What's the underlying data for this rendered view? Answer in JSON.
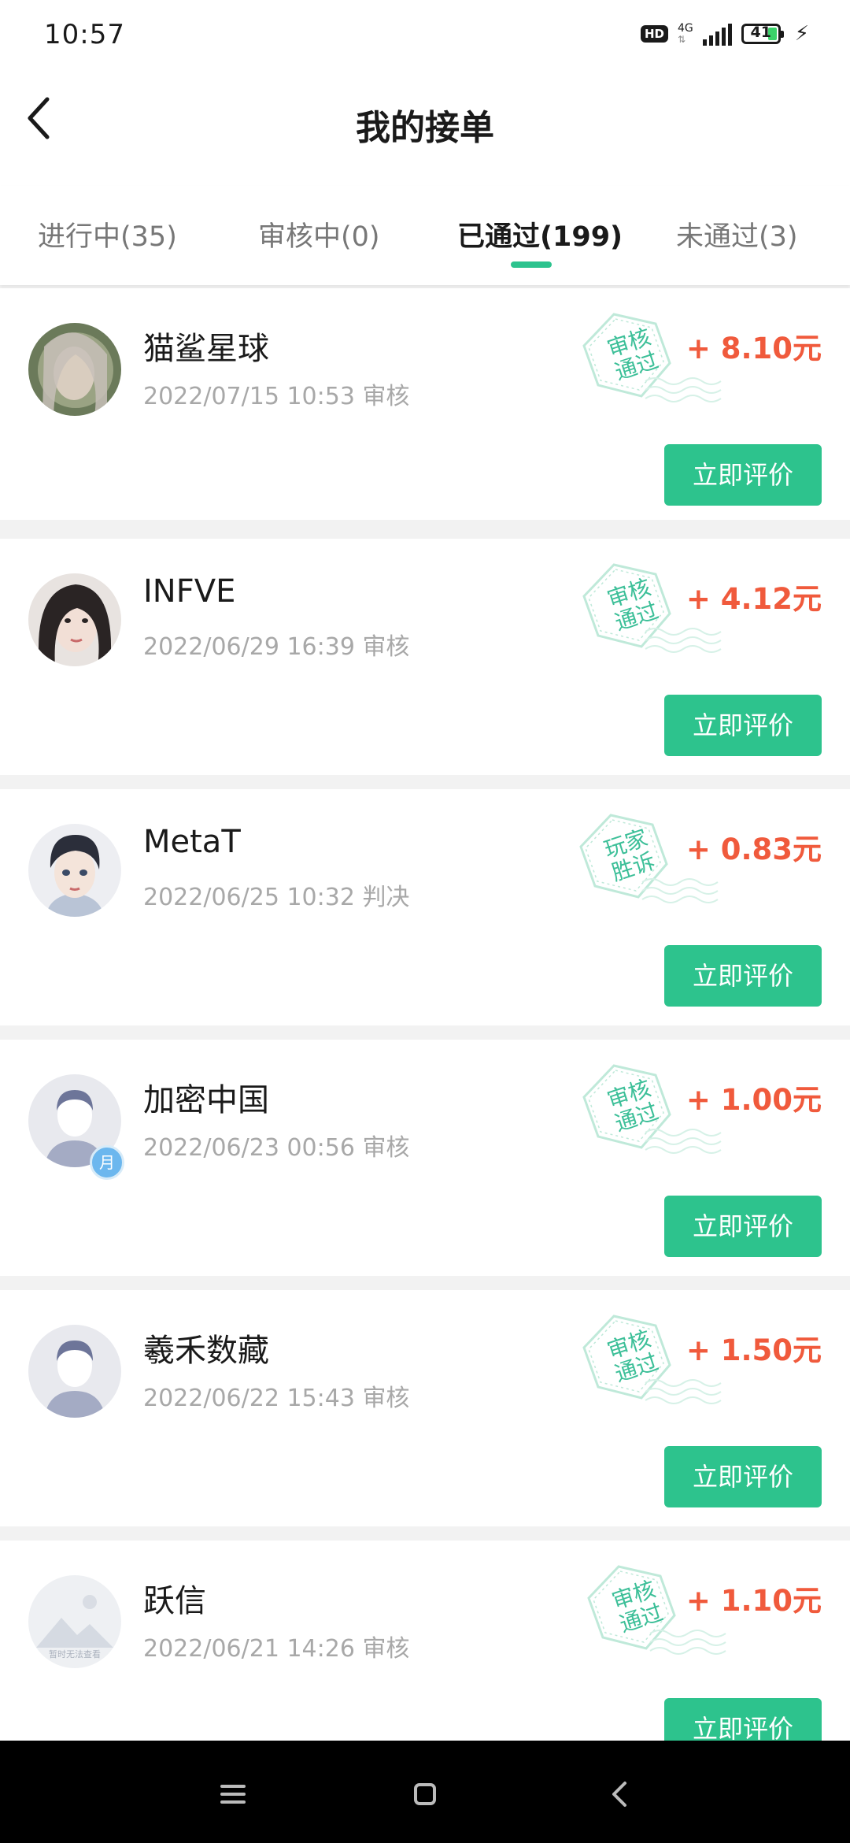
{
  "status_bar": {
    "time": "10:57",
    "hd_label": "HD",
    "network_label": "4G",
    "battery_level": "41"
  },
  "header": {
    "title": "我的接单"
  },
  "tabs": [
    {
      "label": "进行中(35)",
      "active": false
    },
    {
      "label": "审核中(0)",
      "active": false
    },
    {
      "label": "已通过(199)",
      "active": true
    },
    {
      "label": "未通过(3)",
      "active": false
    }
  ],
  "orders": [
    {
      "name": "猫鲨星球",
      "date": "2022/07/15 10:53 审核",
      "stamp": "审核通过",
      "stamp_line1": "审核",
      "stamp_line2": "通过",
      "amount": "+ 8.10元",
      "action_label": "立即评价"
    },
    {
      "name": "INFVE",
      "date": "2022/06/29 16:39 审核",
      "stamp": "审核通过",
      "stamp_line1": "审核",
      "stamp_line2": "通过",
      "amount": "+ 4.12元",
      "action_label": "立即评价"
    },
    {
      "name": "MetaT",
      "date": "2022/06/25 10:32 判决",
      "stamp": "玩家胜诉",
      "stamp_line1": "玩家",
      "stamp_line2": "胜诉",
      "amount": "+ 0.83元",
      "action_label": "立即评价"
    },
    {
      "name": "加密中国",
      "date": "2022/06/23 00:56 审核",
      "stamp": "审核通过",
      "stamp_line1": "审核",
      "stamp_line2": "通过",
      "amount": "+ 1.00元",
      "action_label": "立即评价",
      "badge": "月"
    },
    {
      "name": "羲禾数藏",
      "date": "2022/06/22 15:43 审核",
      "stamp": "审核通过",
      "stamp_line1": "审核",
      "stamp_line2": "通过",
      "amount": "+ 1.50元",
      "action_label": "立即评价"
    },
    {
      "name": "跃信",
      "date": "2022/06/21 14:26 审核",
      "stamp": "审核通过",
      "stamp_line1": "审核",
      "stamp_line2": "通过",
      "amount": "+ 1.10元",
      "action_label": "立即评价",
      "avatar_placeholder_text": "暂时无法查看"
    }
  ],
  "colors": {
    "accent": "#2dc38d",
    "amount": "#f05a3c",
    "stamp": "#3cbf98"
  },
  "icons": {
    "back": "chevron-left-icon",
    "menu": "menu-icon",
    "home": "home-icon",
    "nav_back": "back-icon"
  }
}
